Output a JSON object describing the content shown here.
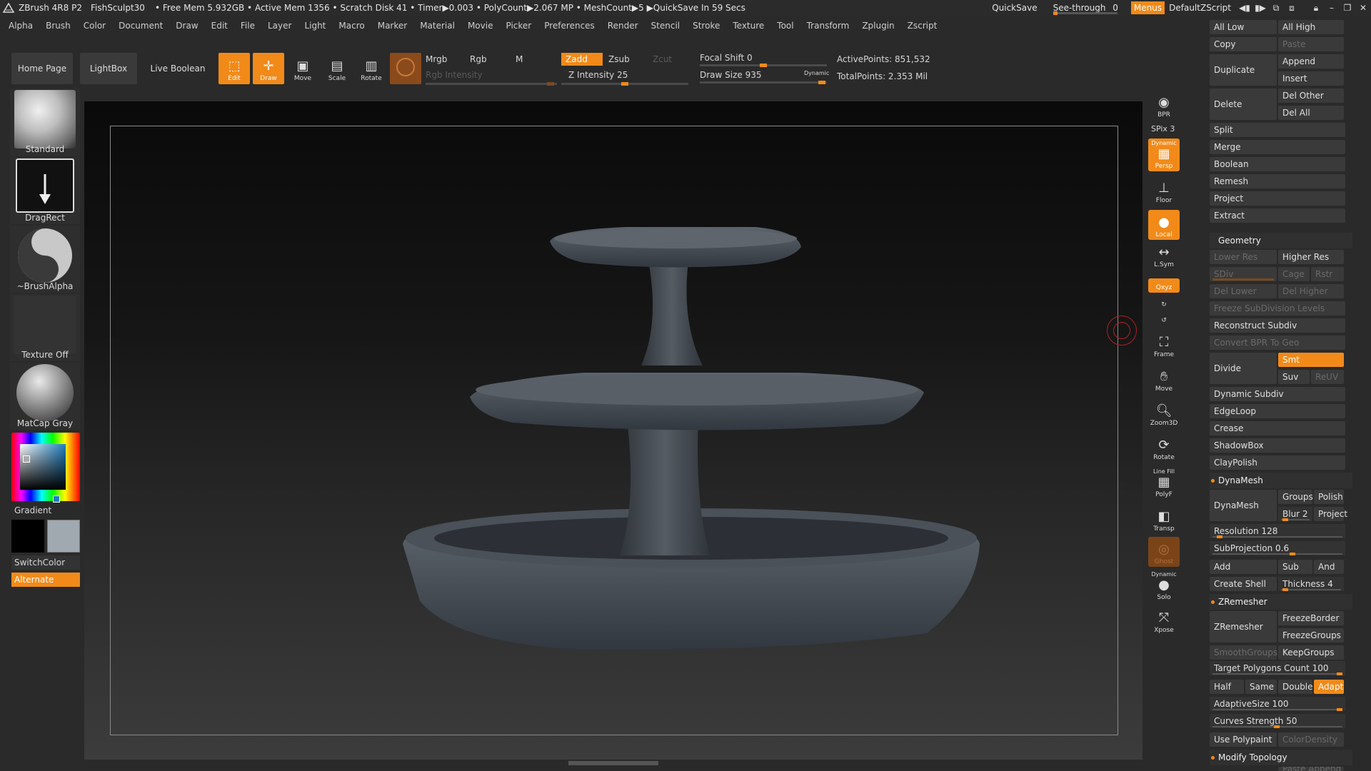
{
  "titlebar": {
    "app": "ZBrush 4R8 P2",
    "file": "FishSculpt30",
    "status": "• Free Mem 5.932GB • Active Mem 1356 • Scratch Disk 41 • Timer▶0.003 • PolyCount▶2.067 MP • MeshCount▶5 ▶QuickSave In 59 Secs",
    "quicksave": "QuickSave",
    "seethrough": "See-through",
    "seethrough_value": "0",
    "menus": "Menus",
    "script": "DefaultZScript"
  },
  "menubar": [
    "Alpha",
    "Brush",
    "Color",
    "Document",
    "Draw",
    "Edit",
    "File",
    "Layer",
    "Light",
    "Macro",
    "Marker",
    "Material",
    "Movie",
    "Picker",
    "Preferences",
    "Render",
    "Stencil",
    "Stroke",
    "Texture",
    "Tool",
    "Transform",
    "Zplugin",
    "Zscript"
  ],
  "shelf": {
    "home": "Home Page",
    "lightbox": "LightBox",
    "liveboolean": "Live Boolean",
    "tools": [
      "Edit",
      "Draw",
      "Move",
      "Scale",
      "Rotate"
    ],
    "mrgb": "Mrgb",
    "rgb": "Rgb",
    "m": "M",
    "rgb_intensity": "Rgb Intensity",
    "zadd": "Zadd",
    "zsub": "Zsub",
    "zcut": "Zcut",
    "z_intensity": "Z Intensity 25",
    "focal_shift": "Focal Shift 0",
    "draw_size": "Draw Size 935",
    "dynamic": "Dynamic",
    "active_points": "ActivePoints: 851,532",
    "total_points": "TotalPoints: 2.353 Mil",
    "z_intensity_level": 25,
    "focal_shift_level": 0,
    "draw_size_level": 935
  },
  "lefttray": {
    "brush": "Standard",
    "stroke": "DragRect",
    "alpha": "~BrushAlpha",
    "texture": "Texture Off",
    "material": "MatCap Gray",
    "gradient": "Gradient",
    "switchcolor": "SwitchColor",
    "alternate": "Alternate"
  },
  "rightshelf": {
    "bpr": "BPR",
    "spix": "SPix 3",
    "persp_top": "Dynamic",
    "persp": "Persp",
    "floor": "Floor",
    "local": "Local",
    "lsym": "L.Sym",
    "xyz": "Qxyz",
    "frame": "Frame",
    "move": "Move",
    "zoom": "Zoom3D",
    "rotate": "Rotate",
    "linefill": "Line Fill",
    "polyf": "PolyF",
    "transp": "Transp",
    "ghost": "Ghost",
    "dynamic_solo": "Dynamic",
    "solo": "Solo",
    "xpose": "Xpose"
  },
  "rightpanel": {
    "alllow": "All Low",
    "allhigh": "All High",
    "copy": "Copy",
    "paste": "Paste",
    "duplicate": "Duplicate",
    "append": "Append",
    "insert": "Insert",
    "delete": "Delete",
    "delother": "Del Other",
    "delall": "Del All",
    "split": "Split",
    "merge": "Merge",
    "boolean": "Boolean",
    "remesh": "Remesh",
    "project": "Project",
    "extract": "Extract",
    "geometry": "Geometry",
    "lowerres": "Lower Res",
    "higherres": "Higher Res",
    "sdiv": "SDiv",
    "cage": "Cage",
    "rstr": "Rstr",
    "dellower": "Del Lower",
    "delhigher": "Del Higher",
    "freezesub": "Freeze SubDivision Levels",
    "reconstruct": "Reconstruct Subdiv",
    "convertbpr": "Convert BPR To Geo",
    "divide": "Divide",
    "smt": "Smt",
    "suv": "Suv",
    "reuv": "ReUV",
    "dynsubdiv": "Dynamic Subdiv",
    "edgeloop": "EdgeLoop",
    "crease": "Crease",
    "shadowbox": "ShadowBox",
    "claypolish": "ClayPolish",
    "dynamesh_head": "DynaMesh",
    "dynamesh": "DynaMesh",
    "groups": "Groups",
    "polish": "Polish",
    "blur": "Blur 2",
    "dm_project": "Project",
    "resolution": "Resolution 128",
    "subprojection": "SubProjection 0.6",
    "add": "Add",
    "sub": "Sub",
    "and": "And",
    "createshell": "Create Shell",
    "thickness": "Thickness 4",
    "zremesher_head": "ZRemesher",
    "zremesher": "ZRemesher",
    "freezeborder": "FreezeBorder",
    "freezegroups": "FreezeGroups",
    "smoothgroups": "SmoothGroups",
    "keepgroups": "KeepGroups",
    "targetpoly": "Target Polygons Count 100",
    "half": "Half",
    "same": "Same",
    "double": "Double",
    "adapt": "Adapt",
    "adaptivesize": "AdaptiveSize 100",
    "curvesstrength": "Curves Strength 50",
    "usepolypaint": "Use Polypaint",
    "colordensity": "ColorDensity",
    "modifytopology": "Modify Topology",
    "pasteappend": "Paste Append"
  },
  "colors": {
    "accent": "#f28a1a",
    "bg": "#2a2a2a",
    "viewport_top": "#0a0a0a",
    "viewport_bottom": "#3c3c3c"
  }
}
